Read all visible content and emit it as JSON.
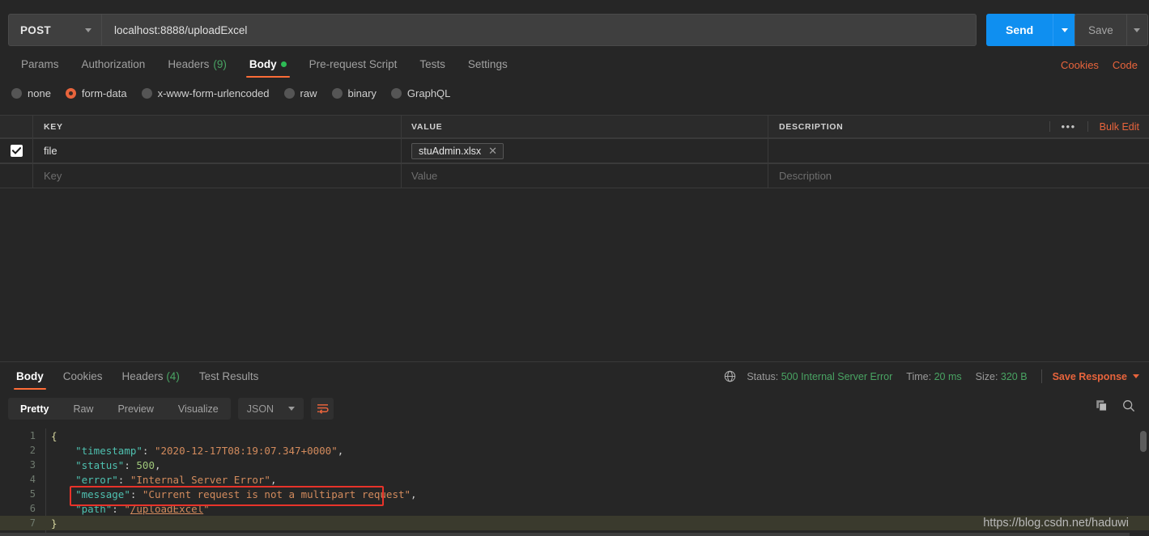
{
  "request": {
    "method": "POST",
    "url": "localhost:8888/uploadExcel",
    "send_label": "Send",
    "save_label": "Save",
    "tabs": [
      {
        "label": "Params",
        "count": "",
        "active": false,
        "dot": false
      },
      {
        "label": "Authorization",
        "count": "",
        "active": false,
        "dot": false
      },
      {
        "label": "Headers",
        "count": "(9)",
        "active": false,
        "dot": false
      },
      {
        "label": "Body",
        "count": "",
        "active": true,
        "dot": true
      },
      {
        "label": "Pre-request Script",
        "count": "",
        "active": false,
        "dot": false
      },
      {
        "label": "Tests",
        "count": "",
        "active": false,
        "dot": false
      },
      {
        "label": "Settings",
        "count": "",
        "active": false,
        "dot": false
      }
    ],
    "links": [
      "Cookies",
      "Code"
    ],
    "body_types": [
      {
        "label": "none",
        "selected": false
      },
      {
        "label": "form-data",
        "selected": true
      },
      {
        "label": "x-www-form-urlencoded",
        "selected": false
      },
      {
        "label": "raw",
        "selected": false
      },
      {
        "label": "binary",
        "selected": false
      },
      {
        "label": "GraphQL",
        "selected": false
      }
    ],
    "table": {
      "headers": {
        "key": "KEY",
        "value": "VALUE",
        "description": "DESCRIPTION"
      },
      "more_label": "•••",
      "bulk_edit_label": "Bulk Edit",
      "rows": [
        {
          "checked": true,
          "key": "file",
          "file_value": "stuAdmin.xlsx",
          "remove_label": "✕",
          "description": ""
        }
      ],
      "placeholders": {
        "key": "Key",
        "value": "Value",
        "description": "Description"
      }
    }
  },
  "response": {
    "tabs": [
      {
        "label": "Body",
        "count": "",
        "active": true
      },
      {
        "label": "Cookies",
        "count": "",
        "active": false
      },
      {
        "label": "Headers",
        "count": "(4)",
        "active": false
      },
      {
        "label": "Test Results",
        "count": "",
        "active": false
      }
    ],
    "meta": {
      "status_label": "Status:",
      "status_value": "500 Internal Server Error",
      "time_label": "Time:",
      "time_value": "20 ms",
      "size_label": "Size:",
      "size_value": "320 B",
      "save_response_label": "Save Response"
    },
    "format_tabs": [
      {
        "label": "Pretty",
        "active": true
      },
      {
        "label": "Raw",
        "active": false
      },
      {
        "label": "Preview",
        "active": false
      },
      {
        "label": "Visualize",
        "active": false
      }
    ],
    "format_select": "JSON",
    "code_lines": [
      {
        "num": "1",
        "highlight": false,
        "tokens": [
          {
            "t": "{",
            "c": "brace"
          }
        ]
      },
      {
        "num": "2",
        "highlight": false,
        "indent": 4,
        "tokens": [
          {
            "t": "\"timestamp\"",
            "c": "k"
          },
          {
            "t": ": ",
            "c": "p"
          },
          {
            "t": "\"2020-12-17T08:19:07.347+0000\"",
            "c": "s"
          },
          {
            "t": ",",
            "c": "p"
          }
        ]
      },
      {
        "num": "3",
        "highlight": false,
        "indent": 4,
        "tokens": [
          {
            "t": "\"status\"",
            "c": "k"
          },
          {
            "t": ": ",
            "c": "p"
          },
          {
            "t": "500",
            "c": "n"
          },
          {
            "t": ",",
            "c": "p"
          }
        ]
      },
      {
        "num": "4",
        "highlight": false,
        "indent": 4,
        "tokens": [
          {
            "t": "\"error\"",
            "c": "k"
          },
          {
            "t": ": ",
            "c": "p"
          },
          {
            "t": "\"Internal Server Error\"",
            "c": "s"
          },
          {
            "t": ",",
            "c": "p"
          }
        ]
      },
      {
        "num": "5",
        "highlight": false,
        "indent": 4,
        "tokens": [
          {
            "t": "\"message\"",
            "c": "k"
          },
          {
            "t": ": ",
            "c": "p"
          },
          {
            "t": "\"Current request is not a multipart request\"",
            "c": "s"
          },
          {
            "t": ",",
            "c": "p"
          }
        ]
      },
      {
        "num": "6",
        "highlight": false,
        "indent": 4,
        "tokens": [
          {
            "t": "\"path\"",
            "c": "k"
          },
          {
            "t": ": ",
            "c": "p"
          },
          {
            "t": "\"",
            "c": "s"
          },
          {
            "t": "/uploadExcel",
            "c": "s underline"
          },
          {
            "t": "\"",
            "c": "s"
          }
        ]
      },
      {
        "num": "7",
        "highlight": true,
        "tokens": [
          {
            "t": "}",
            "c": "brace"
          }
        ]
      }
    ]
  },
  "watermark": "https://blog.csdn.net/haduwi",
  "colors": {
    "accent": "#ff6c37",
    "send": "#0f8ff0",
    "status_green": "#49a463",
    "highlight_box": "#e8332a",
    "background": "#262626"
  }
}
